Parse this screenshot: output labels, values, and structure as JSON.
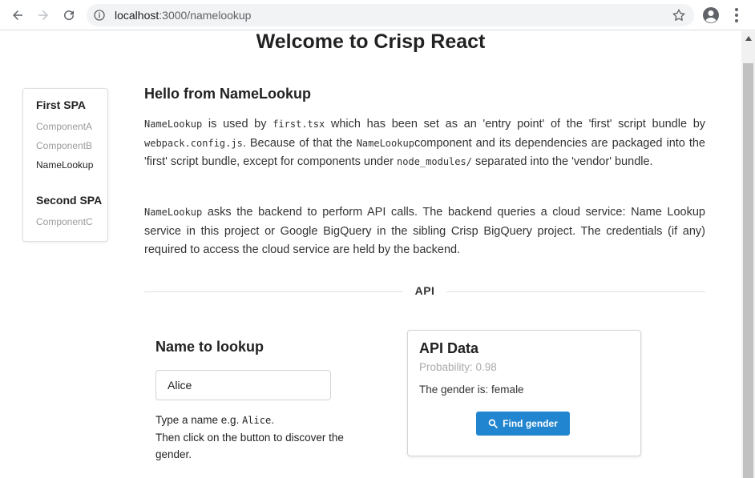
{
  "browser": {
    "url_host": "localhost",
    "url_path": ":3000/namelookup"
  },
  "page": {
    "title": "Welcome to Crisp React"
  },
  "sidebar": {
    "groups": [
      {
        "header": "First SPA",
        "items": [
          "ComponentA",
          "ComponentB",
          "NameLookup"
        ]
      },
      {
        "header": "Second SPA",
        "items": [
          "ComponentC"
        ]
      }
    ],
    "active_item": "NameLookup"
  },
  "content": {
    "heading": "Hello from NameLookup",
    "p1": {
      "c1": "NameLookup",
      "t1": " is used by ",
      "c2": "first.tsx",
      "t2": " which has been set as an 'entry point' of the 'first' script bundle by ",
      "c3": "webpack.config.js",
      "t3": ". Because of that the ",
      "c4": "NameLookup",
      "t4": "component and its dependencies are packaged into the 'first' script bundle, except for components under ",
      "c5": "node_modules/",
      "t5": " separated into the 'vendor' bundle."
    },
    "p2": {
      "c1": "NameLookup",
      "t1": " asks the backend to perform API calls. The backend queries a cloud service: Name Lookup service in this project or Google BigQuery in the sibling Crisp BigQuery project. The credentials (if any) required to access the cloud service are held by the backend."
    },
    "divider_label": "API"
  },
  "lookup": {
    "title": "Name to lookup",
    "input_value": "Alice",
    "hint_prefix": "Type a name e.g. ",
    "hint_code": "Alice",
    "hint_suffix": ".",
    "hint_line2": "Then click on the button to discover the gender."
  },
  "api_card": {
    "title": "API Data",
    "probability": "Probability: 0.98",
    "gender_text": "The gender is: female",
    "button_label": "Find gender"
  }
}
